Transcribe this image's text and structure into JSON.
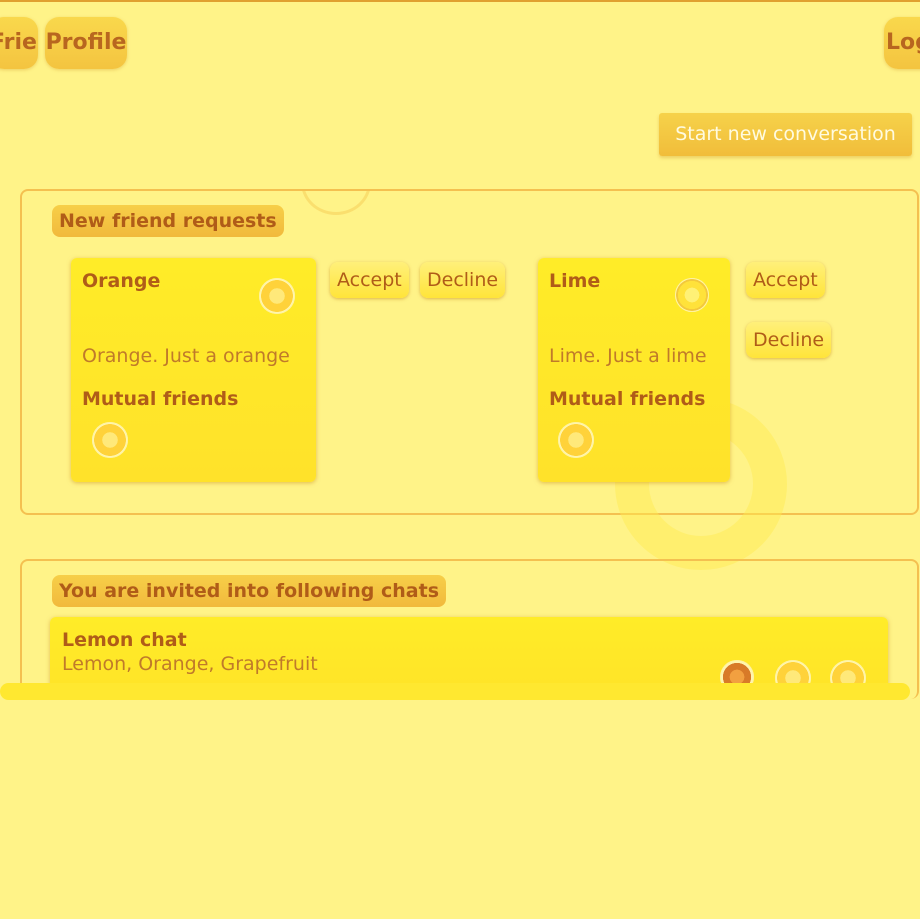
{
  "nav": {
    "friends_label": "Friends",
    "profile_label": "Profile",
    "logout_label": "Logout"
  },
  "start_conversation_label": "Start new conversation",
  "friend_requests": {
    "title": "New friend requests",
    "items": [
      {
        "name": "Orange",
        "description": "Orange. Just a orange",
        "mutual_label": "Mutual friends",
        "accept_label": "Accept",
        "decline_label": "Decline"
      },
      {
        "name": "Lime",
        "description": "Lime. Just a lime",
        "mutual_label": "Mutual friends",
        "accept_label": "Accept",
        "decline_label": "Decline"
      }
    ]
  },
  "chat_invites": {
    "title": "You are invited into following chats",
    "items": [
      {
        "name": "Lemon chat",
        "members": "Lemon, Orange, Grapefruit"
      }
    ]
  },
  "colors": {
    "background": "#fff388",
    "accent": "#f4c440",
    "text": "#b05c18",
    "card": "#ffe82a"
  },
  "icons": [
    "lemon-slice-icon",
    "lime-slice-icon",
    "orange-slice-icon"
  ]
}
